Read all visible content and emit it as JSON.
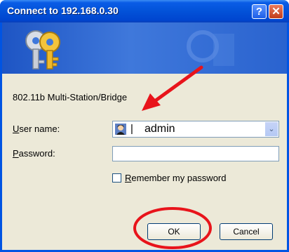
{
  "window": {
    "title": "Connect to 192.168.0.30",
    "help_glyph": "?",
    "close_glyph": "✕"
  },
  "dialog": {
    "realm": "802.11b Multi-Station/Bridge",
    "username_label_first": "U",
    "username_label_rest": "ser name:",
    "username_value": "admin",
    "username_separator": "|",
    "password_label_first": "P",
    "password_label_rest": "assword:",
    "password_value": "",
    "remember_label_first": "R",
    "remember_label_rest": "emember my password",
    "remember_checked": false,
    "ok_label": "OK",
    "cancel_label": "Cancel",
    "dropdown_glyph": "⌄"
  },
  "colors": {
    "titlebar": "#0252d8",
    "annotation_red": "#e8141b"
  },
  "icons": [
    "keys-icon",
    "user-avatar-icon",
    "help-icon",
    "close-icon",
    "chevron-down-icon"
  ]
}
